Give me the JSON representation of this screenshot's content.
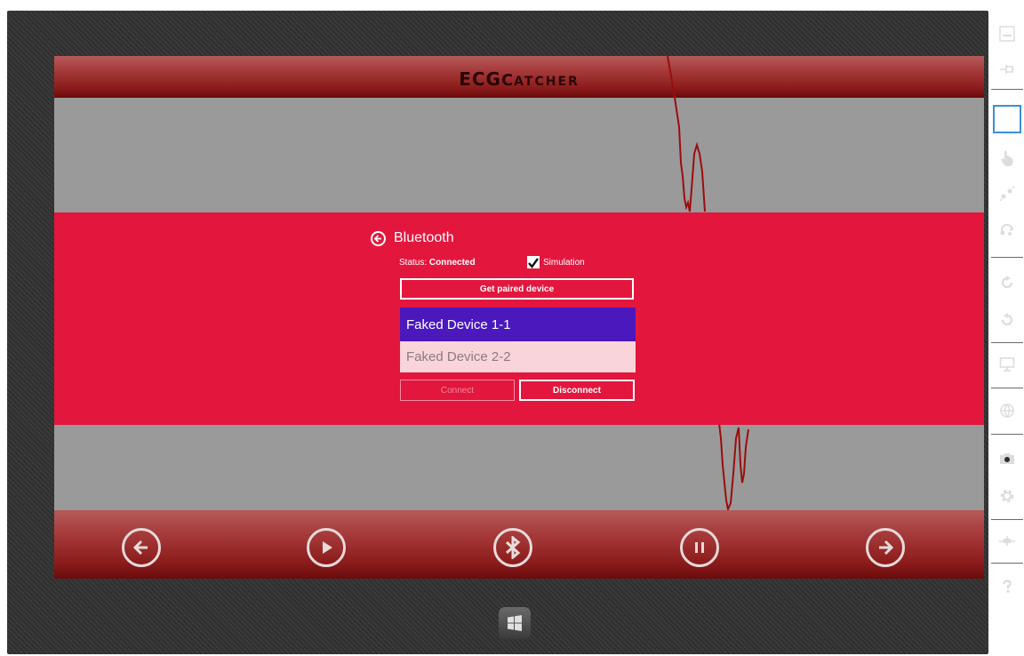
{
  "header": {
    "title_big1": "ECG",
    "title_cap": "C",
    "title_small": "ATCHER"
  },
  "flyout": {
    "title": "Bluetooth",
    "status_label": "Status:",
    "status_value": "Connected",
    "simulation_label": "Simulation",
    "simulation_checked": true,
    "get_paired_label": "Get paired device",
    "devices": [
      "Faked Device 1-1",
      "Faked Device 2-2"
    ],
    "selected_device": "Faked Device 1-1",
    "connect_label": "Connect",
    "disconnect_label": "Disconnect"
  },
  "footer": {
    "buttons": [
      "arrow-left-icon",
      "play-icon",
      "bluetooth-icon",
      "pause-icon",
      "arrow-right-icon"
    ]
  },
  "toolbar": {
    "tools": [
      "minimize-icon",
      "pin-icon",
      "pointer-icon",
      "touch-icon",
      "pinch-icon",
      "rotate-touch-icon",
      "rotate-clockwise-icon",
      "rotate-counterclockwise-icon",
      "monitor-icon",
      "globe-icon",
      "camera-icon",
      "settings-icon",
      "network-icon",
      "help-icon"
    ],
    "selected_tool": "pointer-icon"
  },
  "colors": {
    "accent": "#e3163e",
    "selected_item": "#4a18bd",
    "header_red": "#8d1d1d",
    "background_gray": "#9a9a9a"
  }
}
